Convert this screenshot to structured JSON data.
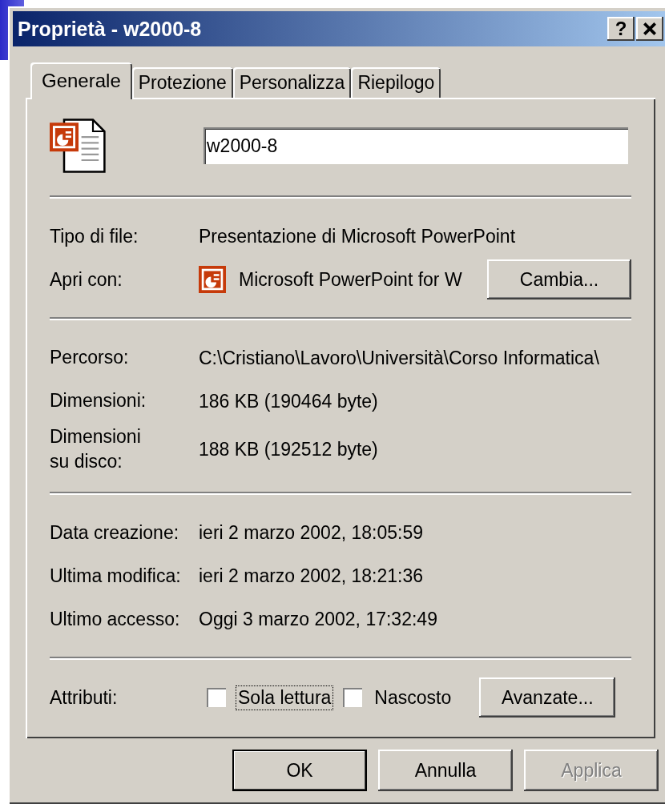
{
  "window": {
    "title": "Proprietà - w2000-8",
    "help_button": "?"
  },
  "tabs": [
    {
      "label": "Generale",
      "selected": true
    },
    {
      "label": "Protezione",
      "selected": false
    },
    {
      "label": "Personalizza",
      "selected": false
    },
    {
      "label": "Riepilogo",
      "selected": false
    }
  ],
  "name_field": {
    "value": "w2000-8"
  },
  "file_info": [
    {
      "label": "Tipo di file:",
      "value": "Presentazione di Microsoft PowerPoint"
    },
    {
      "label": "Apri con:",
      "value": "Microsoft PowerPoint for W",
      "button": "Cambia..."
    }
  ],
  "location_info": [
    {
      "label": "Percorso:",
      "value": "C:\\Cristiano\\Lavoro\\Università\\Corso Informatica\\"
    },
    {
      "label": "Dimensioni:",
      "value": "186 KB (190464 byte)"
    },
    {
      "label": "Dimensioni\nsu disco:",
      "value": "188 KB (192512 byte)"
    }
  ],
  "dates": [
    {
      "label": "Data creazione:",
      "value": "ieri 2 marzo 2002, 18:05:59"
    },
    {
      "label": "Ultima modifica:",
      "value": "ieri 2 marzo 2002, 18:21:36"
    },
    {
      "label": "Ultimo accesso:",
      "value": "Oggi 3 marzo 2002, 17:32:49"
    }
  ],
  "attributes": {
    "label": "Attributi:",
    "checkboxes": [
      {
        "label": "Sola lettura",
        "checked": false,
        "focused": true
      },
      {
        "label": "Nascosto",
        "checked": false,
        "focused": false
      }
    ],
    "button": "Avanzate..."
  },
  "buttons": [
    {
      "label": "OK",
      "default": true,
      "disabled": false
    },
    {
      "label": "Annulla",
      "default": false,
      "disabled": false
    },
    {
      "label": "Applica",
      "default": false,
      "disabled": true
    }
  ]
}
